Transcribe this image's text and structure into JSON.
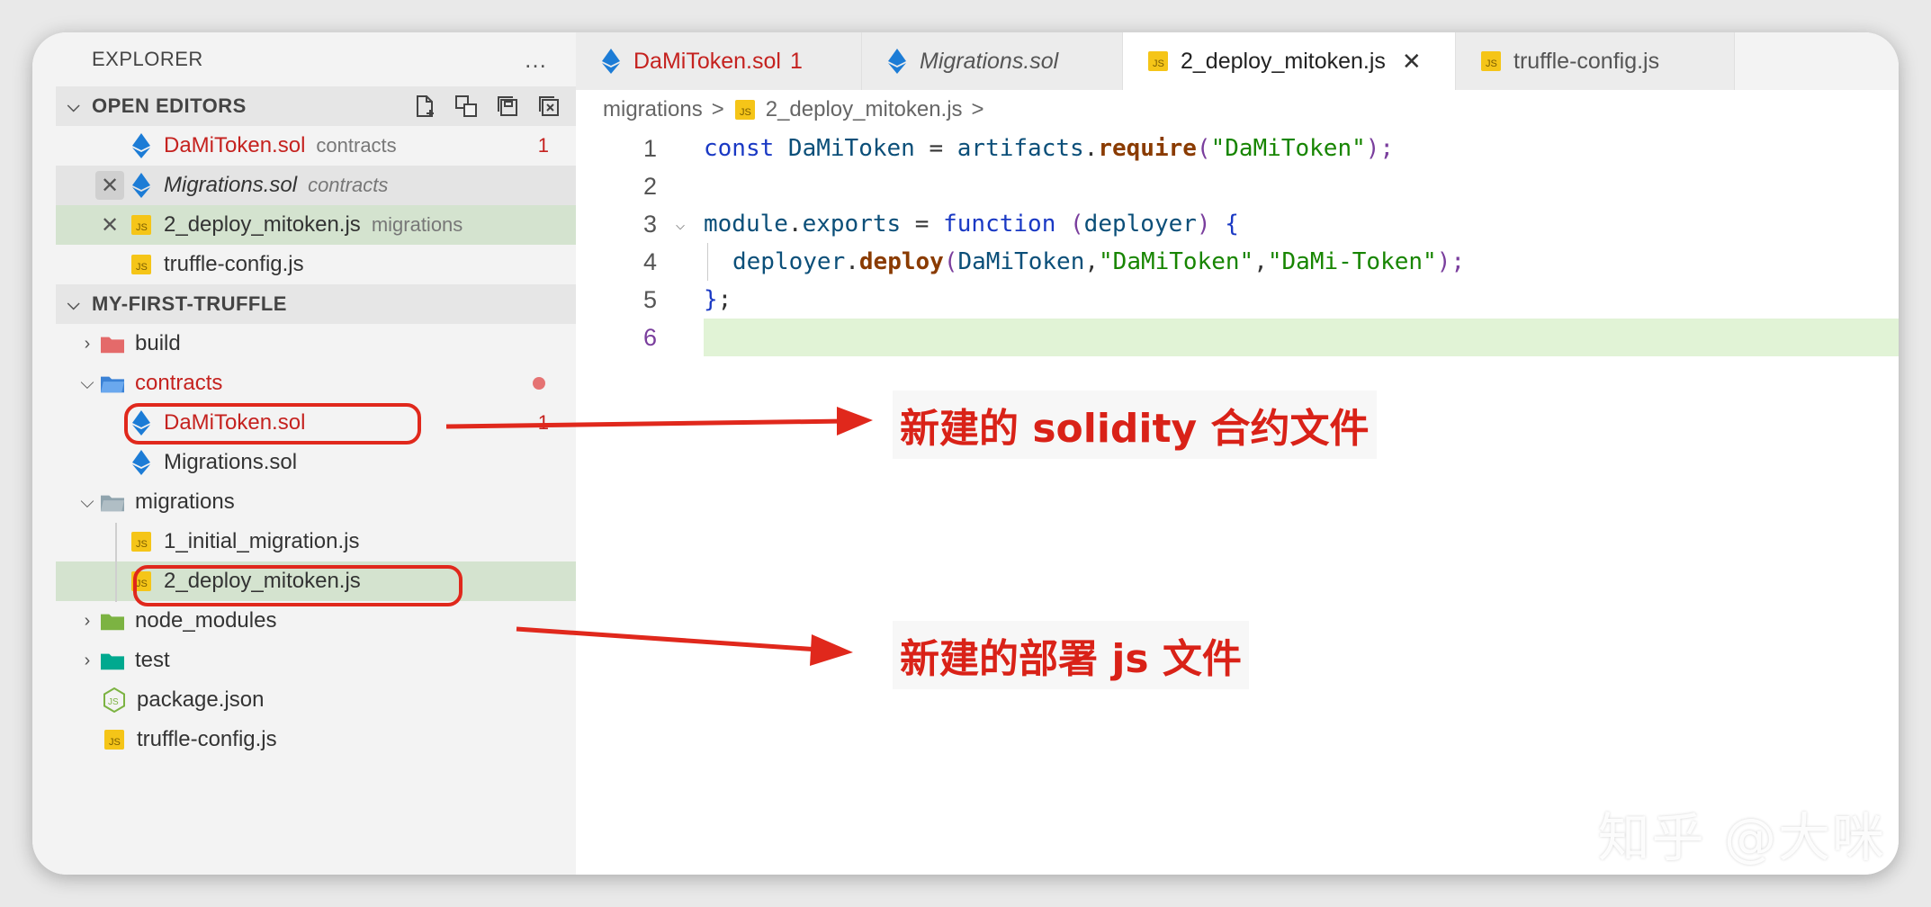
{
  "sidebar": {
    "title": "EXPLORER",
    "more_icon": "…",
    "open_editors_label": "OPEN EDITORS",
    "open_editors": [
      {
        "name": "DaMiToken.sol",
        "desc": "contracts",
        "badge": "1"
      },
      {
        "name": "Migrations.sol",
        "desc": "contracts"
      },
      {
        "name": "2_deploy_mitoken.js",
        "desc": "migrations"
      },
      {
        "name": "truffle-config.js",
        "desc": ""
      }
    ],
    "project_label": "MY-FIRST-TRUFFLE",
    "tree": [
      {
        "name": "build"
      },
      {
        "name": "contracts"
      },
      {
        "name": "DaMiToken.sol",
        "badge": "1"
      },
      {
        "name": "Migrations.sol"
      },
      {
        "name": "migrations"
      },
      {
        "name": "1_initial_migration.js"
      },
      {
        "name": "2_deploy_mitoken.js"
      },
      {
        "name": "node_modules"
      },
      {
        "name": "test"
      },
      {
        "name": "package.json"
      },
      {
        "name": "truffle-config.js"
      }
    ]
  },
  "tabs": [
    {
      "label": "DaMiToken.sol",
      "badge": "1"
    },
    {
      "label": "Migrations.sol"
    },
    {
      "label": "2_deploy_mitoken.js",
      "close": "✕"
    },
    {
      "label": "truffle-config.js"
    }
  ],
  "breadcrumb": {
    "folder": "migrations",
    "file": "2_deploy_mitoken.js",
    "sep": ">",
    "trail": ">"
  },
  "code": {
    "line_numbers": [
      "1",
      "2",
      "3",
      "4",
      "5",
      "6"
    ],
    "l1": {
      "kw": "const",
      "var": " DaMiToken ",
      "eq": "= ",
      "obj": "artifacts",
      "dot": ".",
      "fn": "require",
      "open": "(",
      "str": "\"DaMiToken\"",
      "close": ");"
    },
    "l3": {
      "obj": "module",
      "dot": ".",
      "prop": "exports",
      "eq": " = ",
      "kw": "function",
      "sp": " ",
      "open": "(",
      "param": "deployer",
      "close": ")",
      "brace": " {"
    },
    "l4": {
      "obj": "deployer",
      "dot": ".",
      "fn": "deploy",
      "open": "(",
      "arg": "DaMiToken",
      "c1": ",",
      "s1": "\"DaMiToken\"",
      "c2": ",",
      "s2": "\"DaMi-Token\"",
      "close": ");"
    },
    "l5": {
      "brace": "}",
      "semi": ";"
    }
  },
  "annotations": {
    "sol_note": "新建的 solidity 合约文件",
    "js_note": "新建的部署 js 文件"
  },
  "watermark": "知乎 @大咪",
  "colors": {
    "accent_red": "#d92218",
    "selection": "#d4e3cf",
    "current_line": "#e1f3d6"
  }
}
